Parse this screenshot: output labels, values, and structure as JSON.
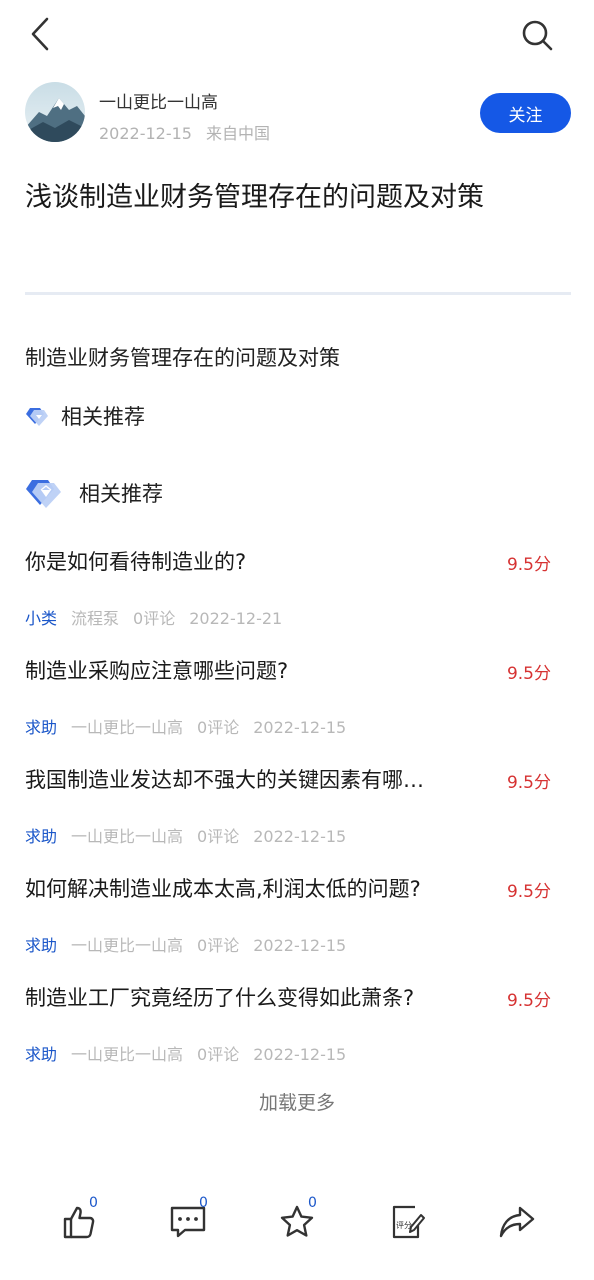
{
  "author": {
    "name": "一山更比一山高",
    "date": "2022-12-15",
    "location": "来自中国",
    "follow_label": "关注"
  },
  "article": {
    "title": "浅谈制造业财务管理存在的问题及对策",
    "summary": "制造业财务管理存在的问题及对策"
  },
  "related": {
    "small_label": "相关推荐",
    "big_label": "相关推荐"
  },
  "recommendations": [
    {
      "title": "你是如何看待制造业的?",
      "score": "9.5分",
      "tag": "小类",
      "author": "流程泵",
      "comments": "0评论",
      "date": "2022-12-21"
    },
    {
      "title": "制造业采购应注意哪些问题?",
      "score": "9.5分",
      "tag": "求助",
      "author": "一山更比一山高",
      "comments": "0评论",
      "date": "2022-12-15"
    },
    {
      "title": "我国制造业发达却不强大的关键因素有哪…",
      "score": "9.5分",
      "tag": "求助",
      "author": "一山更比一山高",
      "comments": "0评论",
      "date": "2022-12-15"
    },
    {
      "title": "如何解决制造业成本太高,利润太低的问题?",
      "score": "9.5分",
      "tag": "求助",
      "author": "一山更比一山高",
      "comments": "0评论",
      "date": "2022-12-15"
    },
    {
      "title": "制造业工厂究竟经历了什么变得如此萧条?",
      "score": "9.5分",
      "tag": "求助",
      "author": "一山更比一山高",
      "comments": "0评论",
      "date": "2022-12-15"
    }
  ],
  "load_more": "加载更多",
  "bottom_bar": {
    "like_count": "0",
    "comment_count": "0",
    "favorite_count": "0",
    "rate_label": "评分"
  },
  "colors": {
    "accent": "#1558e6",
    "tag": "#1a56c9",
    "score": "#d63232"
  },
  "icons": {
    "back": "chevron-left-icon",
    "search": "search-icon",
    "related": "diamond-badge-icon",
    "like": "thumbs-up-icon",
    "comment": "comment-icon",
    "favorite": "star-icon",
    "rate": "rate-icon",
    "share": "share-icon"
  }
}
